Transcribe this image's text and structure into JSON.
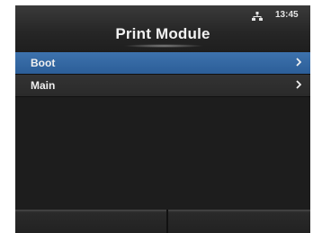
{
  "header": {
    "title": "Print Module",
    "time": "13:45",
    "network_icon": "network-icon"
  },
  "menu": {
    "items": [
      {
        "label": "Boot",
        "selected": true,
        "icon": "chevron-right-icon"
      },
      {
        "label": "Main",
        "selected": false,
        "icon": "chevron-right-icon"
      }
    ]
  },
  "colors": {
    "selection": "#2f649f",
    "background": "#1d1d1d"
  }
}
